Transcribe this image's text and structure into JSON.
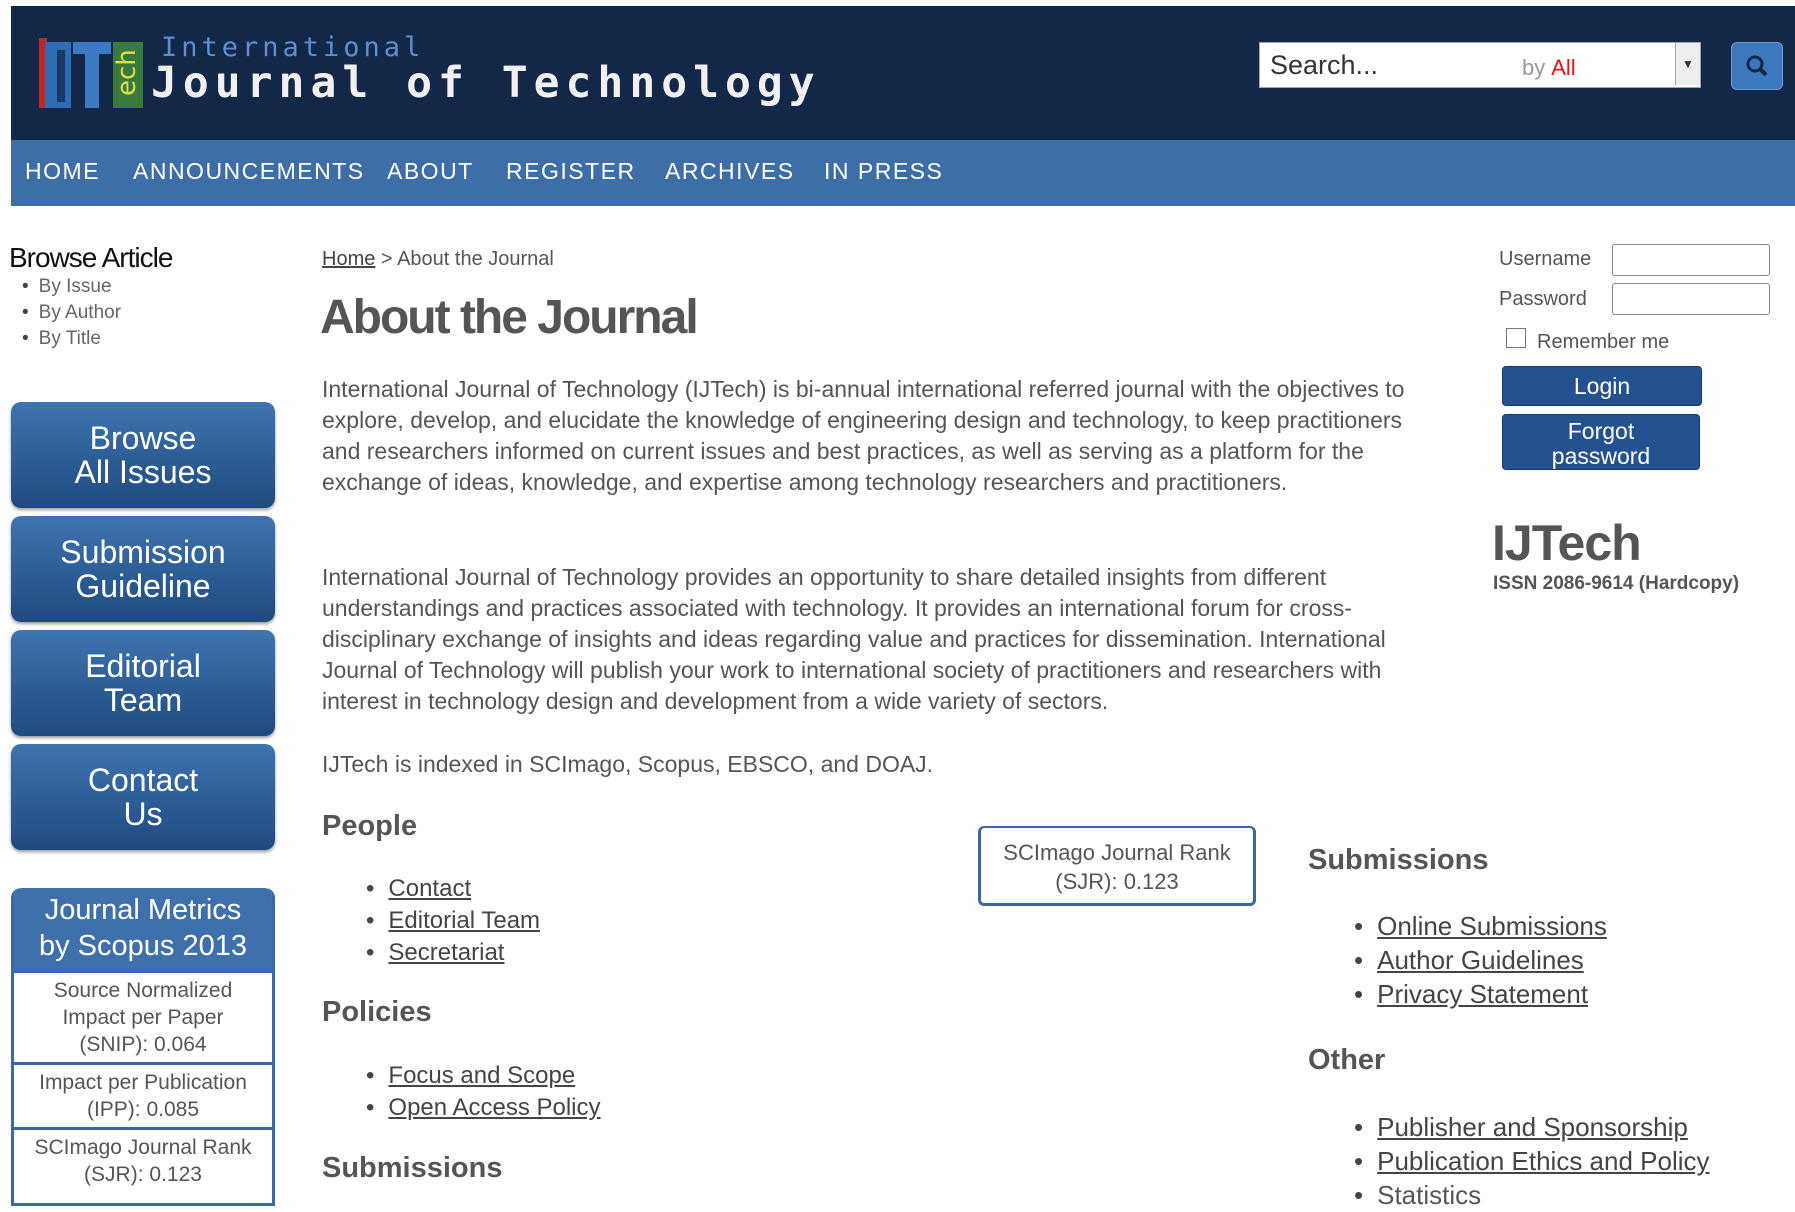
{
  "header": {
    "logo_letters": "IJTech",
    "logo_small": "International",
    "logo_big": "Journal of Technology",
    "search_placeholder": "Search...",
    "search_by_label": "by",
    "search_by_value": "All",
    "colors": {
      "header_bg": "#132748",
      "nav_bg": "#3d6ea7",
      "accent_red": "#e11111"
    }
  },
  "nav": {
    "items": [
      "HOME",
      "ANNOUNCEMENTS",
      "ABOUT",
      "REGISTER",
      "ARCHIVES",
      "IN PRESS"
    ]
  },
  "sidebar": {
    "browse_title": "Browse Article",
    "browse_items": [
      "By Issue",
      "By Author",
      "By Title"
    ],
    "buttons": [
      {
        "line1": "Browse",
        "line2": "All Issues"
      },
      {
        "line1": "Submission",
        "line2": "Guideline"
      },
      {
        "line1": "Editorial",
        "line2": "Team"
      },
      {
        "line1": "Contact",
        "line2": "Us"
      }
    ],
    "metrics": {
      "title_line1": "Journal Metrics",
      "title_line2": "by Scopus 2013",
      "items": [
        {
          "l1": "Source Normalized",
          "l2": "Impact per Paper",
          "l3": "(SNIP): 0.064"
        },
        {
          "l1": "Impact per Publication",
          "l2": "(IPP): 0.085"
        },
        {
          "l1": "SCImago Journal Rank",
          "l2": "(SJR): 0.123"
        }
      ]
    }
  },
  "main": {
    "breadcrumb_home": "Home",
    "breadcrumb_sep": ">",
    "breadcrumb_current": "About the Journal",
    "title": "About the Journal",
    "para1": "International Journal of Technology (IJTech) is bi-annual international referred journal with the objectives to explore, develop, and elucidate the knowledge of engineering design and technology, to keep practitioners and researchers informed on current issues and best practices, as well as serving as a platform for the exchange of ideas, knowledge, and expertise among technology researchers and practitioners.",
    "para2": "International Journal of Technology provides an opportunity to share detailed insights from different understandings and practices associated with technology. It provides an international forum for cross-disciplinary exchange of insights and ideas regarding value and practices for dissemination. International Journal of Technology will publish your work to international society of practitioners and researchers with interest in technology design and development from a wide variety of sectors.",
    "para3": "IJTech is indexed in SCImago, Scopus, EBSCO, and DOAJ.",
    "people_heading": "People",
    "people_links": [
      "Contact",
      "Editorial Team",
      "Secretariat"
    ],
    "policies_heading": "Policies",
    "policies_links": [
      "Focus and Scope",
      "Open Access Policy"
    ],
    "submissions_heading_left": "Submissions",
    "sjr_box_line1": "SCImago Journal Rank",
    "sjr_box_line2": "(SJR): 0.123",
    "submissions_heading": "Submissions",
    "submissions_links": [
      "Online Submissions",
      "Author Guidelines",
      "Privacy Statement"
    ],
    "other_heading": "Other",
    "other_links": [
      "Publisher and Sponsorship",
      "Publication Ethics and Policy"
    ],
    "other_plain": "Statistics"
  },
  "login": {
    "username_label": "Username",
    "password_label": "Password",
    "remember_label": "Remember me",
    "login_button": "Login",
    "forgot_line1": "Forgot",
    "forgot_line2": "password",
    "brand": "IJTech",
    "issn": "ISSN 2086-9614 (Hardcopy)"
  }
}
